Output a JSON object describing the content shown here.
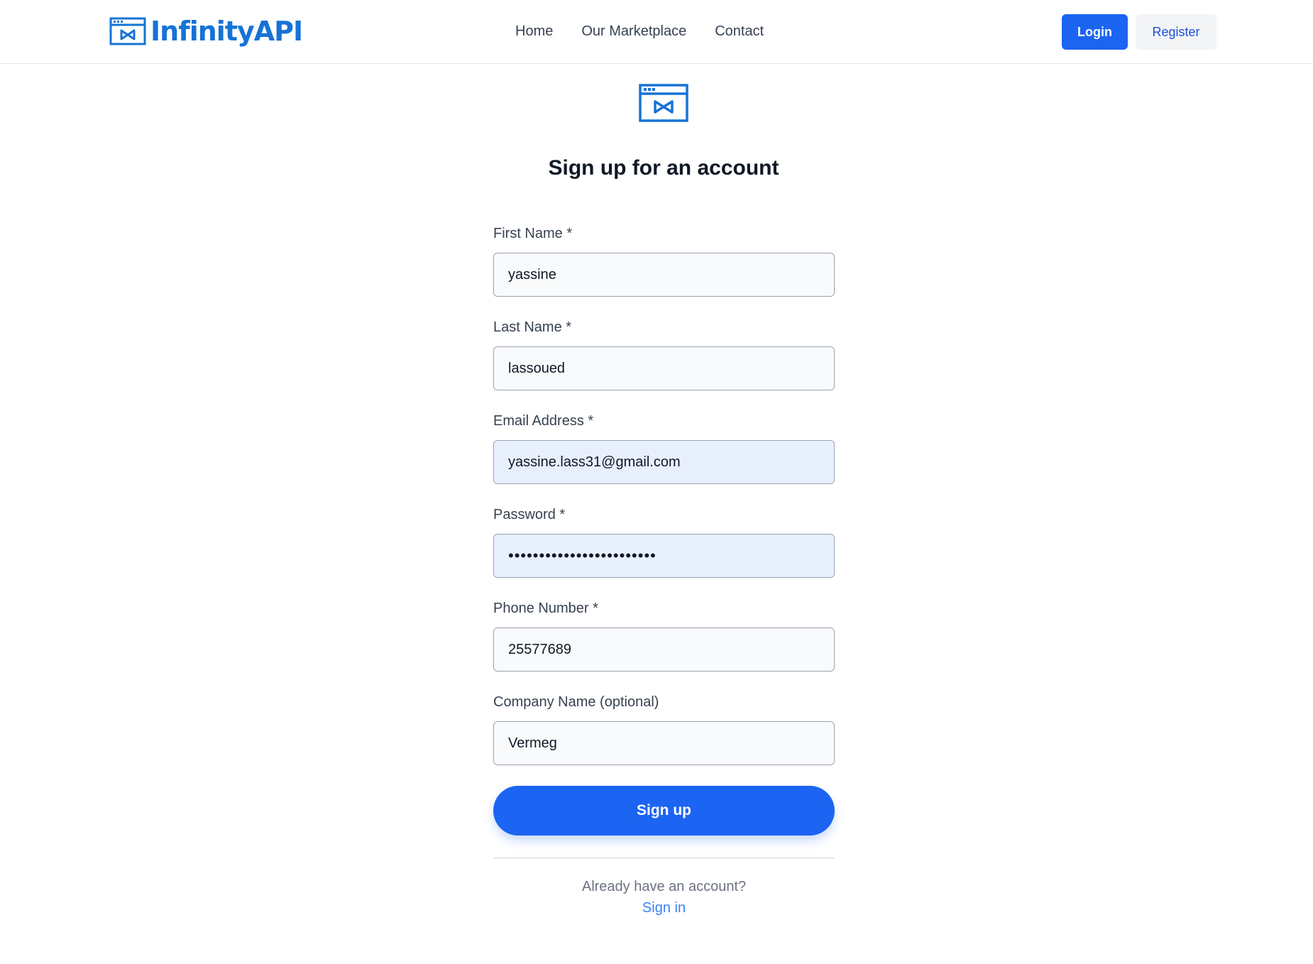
{
  "header": {
    "brand_name": "InfinityAPI",
    "brand_color": "#1673d6",
    "nav": [
      {
        "label": "Home"
      },
      {
        "label": "Our Marketplace"
      },
      {
        "label": "Contact"
      }
    ],
    "login_label": "Login",
    "register_label": "Register"
  },
  "main": {
    "title": "Sign up for an account",
    "fields": [
      {
        "label": "First Name *",
        "value": "yassine"
      },
      {
        "label": "Last Name *",
        "value": "lassoued"
      },
      {
        "label": "Email Address *",
        "value": "yassine.lass31@gmail.com"
      },
      {
        "label": "Password *",
        "value": "••••••••••••••••••••••••"
      },
      {
        "label": "Phone Number *",
        "value": "25577689"
      },
      {
        "label": "Company Name (optional)",
        "value": "Vermeg"
      }
    ],
    "submit_label": "Sign up",
    "already_text": "Already have an account?",
    "signin_label": "Sign in"
  },
  "colors": {
    "primary": "#1c64f2",
    "logo": "#1673d6"
  },
  "icons": {
    "brand": "api-window-icon",
    "center": "api-window-icon"
  }
}
